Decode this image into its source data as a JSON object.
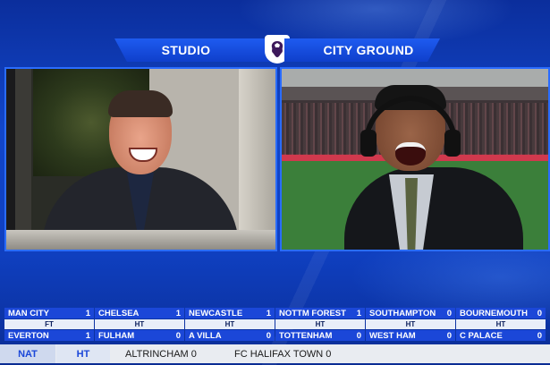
{
  "header": {
    "left_label": "STUDIO",
    "right_label": "CITY GROUND",
    "logo_icon": "premier-league-lion-icon"
  },
  "colors": {
    "brand_blue": "#1b47d8",
    "header_blue": "#1e5bf0",
    "status_bg": "#e8eef9",
    "bottom_bg": "#e9ecf1"
  },
  "scores": [
    {
      "home": "MAN CITY",
      "home_score": "1",
      "status": "FT",
      "away": "EVERTON",
      "away_score": "1"
    },
    {
      "home": "CHELSEA",
      "home_score": "1",
      "status": "HT",
      "away": "FULHAM",
      "away_score": "0"
    },
    {
      "home": "NEWCASTLE",
      "home_score": "1",
      "status": "HT",
      "away": "A VILLA",
      "away_score": "0"
    },
    {
      "home": "NOTTM FOREST",
      "home_score": "1",
      "status": "HT",
      "away": "TOTTENHAM",
      "away_score": "0"
    },
    {
      "home": "SOUTHAMPTON",
      "home_score": "0",
      "status": "HT",
      "away": "WEST HAM",
      "away_score": "0"
    },
    {
      "home": "BOURNEMOUTH",
      "home_score": "0",
      "status": "HT",
      "away": "C PALACE",
      "away_score": "0"
    }
  ],
  "bottom": {
    "nat_label": "NAT",
    "ht_label": "HT",
    "home_team": "ALTRINCHAM 0",
    "away_team": "FC HALIFAX TOWN 0"
  }
}
